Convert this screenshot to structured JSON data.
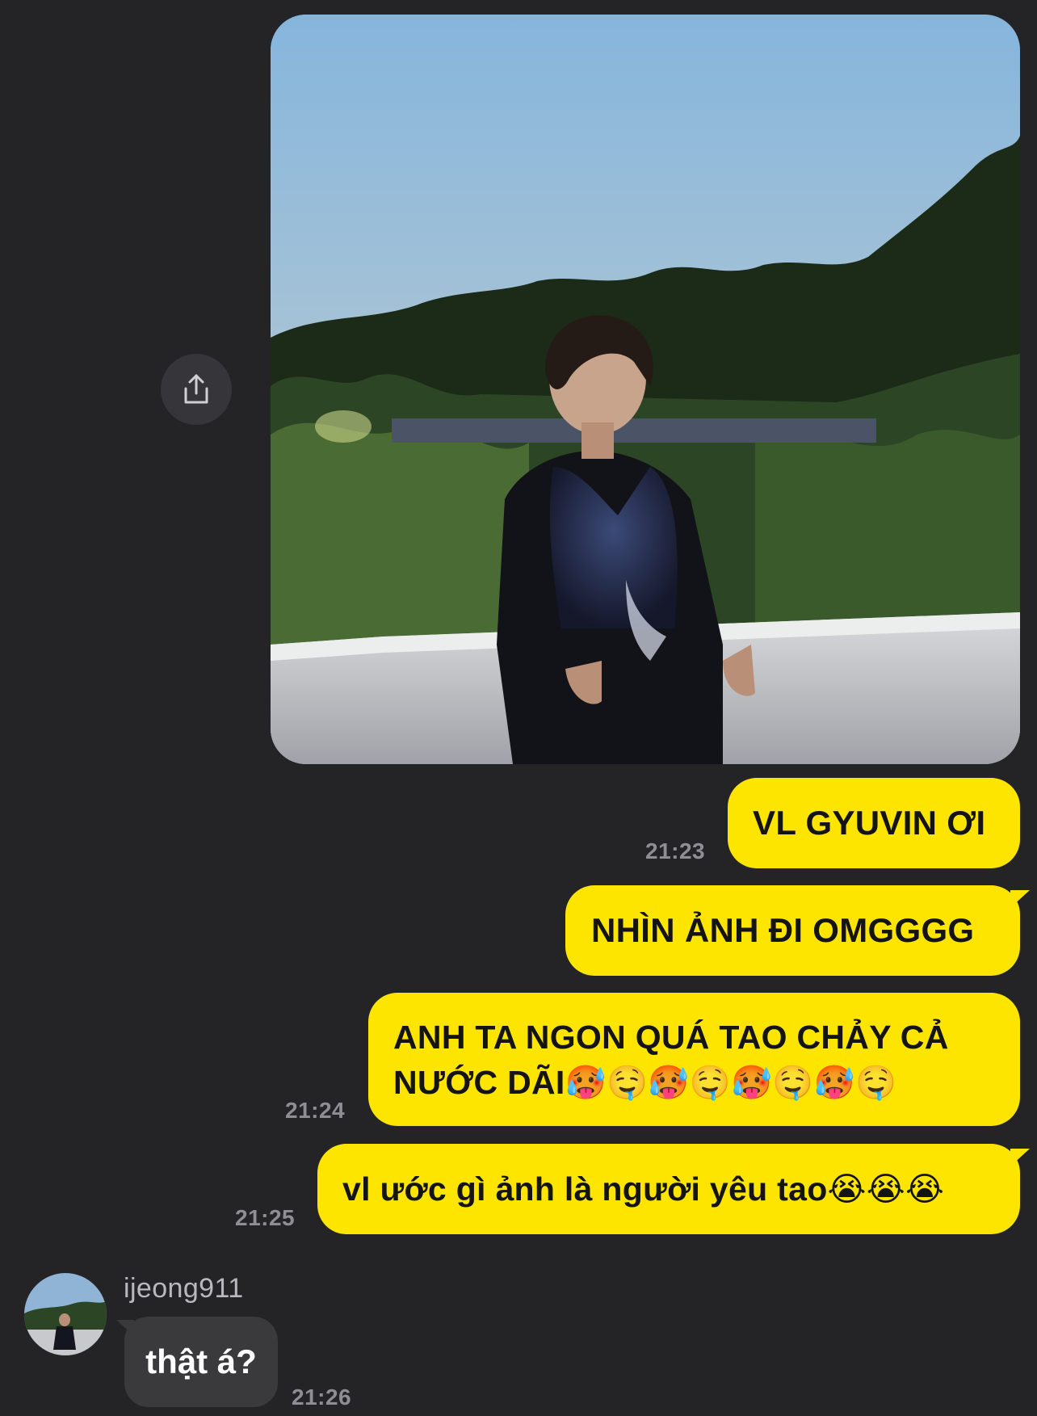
{
  "chat": {
    "messages_out": [
      {
        "text": "VL GYUVIN ƠI",
        "time": "21:23"
      },
      {
        "text": "NHÌN ẢNH ĐI OMGGGG"
      },
      {
        "text": "ANH TA NGON QUÁ TAO CHẢY CẢ NƯỚC DÃI🥵🤤🥵🤤🥵🤤🥵🤤",
        "time": "21:24"
      },
      {
        "text": "vl ước gì ảnh là người yêu tao😭😭😭",
        "time": "21:25"
      }
    ],
    "incoming": {
      "sender": "ijeong911",
      "text": "thật á?",
      "time": "21:26"
    },
    "share_icon": "share-icon",
    "colors": {
      "background": "#242426",
      "outgoing_bubble": "#fee500",
      "incoming_bubble": "#3a3a3d",
      "timestamp": "#8e8e93"
    }
  }
}
